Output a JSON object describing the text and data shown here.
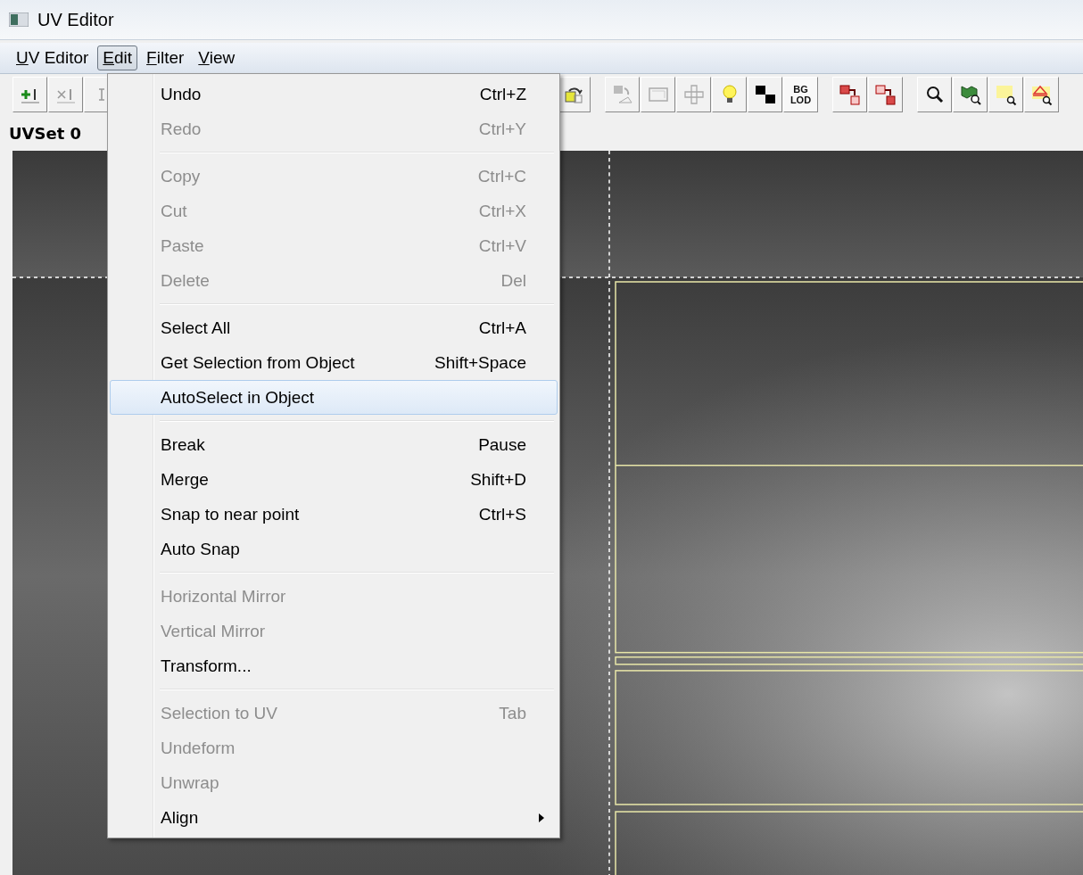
{
  "window": {
    "title": "UV Editor"
  },
  "menu_bar": [
    {
      "label": "UV Editor",
      "selected": false
    },
    {
      "label": "Edit",
      "selected": true
    },
    {
      "label": "Filter",
      "selected": false
    },
    {
      "label": "View",
      "selected": false
    }
  ],
  "toolbar": {
    "lod_button": "BG LOD"
  },
  "uv_set_label": "UVSet 0",
  "edit_menu": {
    "items": [
      {
        "kind": "item",
        "label": "Undo",
        "shortcut": "Ctrl+Z",
        "disabled": false,
        "selected": false
      },
      {
        "kind": "item",
        "label": "Redo",
        "shortcut": "Ctrl+Y",
        "disabled": true,
        "selected": false
      },
      {
        "kind": "separator"
      },
      {
        "kind": "item",
        "label": "Copy",
        "shortcut": "Ctrl+C",
        "disabled": true,
        "selected": false
      },
      {
        "kind": "item",
        "label": "Cut",
        "shortcut": "Ctrl+X",
        "disabled": true,
        "selected": false
      },
      {
        "kind": "item",
        "label": "Paste",
        "shortcut": "Ctrl+V",
        "disabled": true,
        "selected": false
      },
      {
        "kind": "item",
        "label": "Delete",
        "shortcut": "Del",
        "disabled": true,
        "selected": false
      },
      {
        "kind": "separator"
      },
      {
        "kind": "item",
        "label": "Select All",
        "shortcut": "Ctrl+A",
        "disabled": false,
        "selected": false
      },
      {
        "kind": "item",
        "label": "Get Selection from Object",
        "shortcut": "Shift+Space",
        "disabled": false,
        "selected": false
      },
      {
        "kind": "item",
        "label": "AutoSelect in Object",
        "disabled": false,
        "selected": true
      },
      {
        "kind": "separator"
      },
      {
        "kind": "item",
        "label": "Break",
        "shortcut": "Pause",
        "disabled": false,
        "selected": false
      },
      {
        "kind": "item",
        "label": "Merge",
        "shortcut": "Shift+D",
        "disabled": false,
        "selected": false
      },
      {
        "kind": "item",
        "label": "Snap to near point",
        "shortcut": "Ctrl+S",
        "disabled": false,
        "selected": false
      },
      {
        "kind": "item",
        "label": "Auto Snap",
        "disabled": false,
        "selected": false
      },
      {
        "kind": "separator"
      },
      {
        "kind": "item",
        "label": "Horizontal Mirror",
        "disabled": true,
        "selected": false
      },
      {
        "kind": "item",
        "label": "Vertical Mirror",
        "disabled": true,
        "selected": false
      },
      {
        "kind": "item",
        "label": "Transform...",
        "disabled": false,
        "selected": false
      },
      {
        "kind": "separator"
      },
      {
        "kind": "item",
        "label": "Selection to UV",
        "shortcut": "Tab",
        "disabled": true,
        "selected": false
      },
      {
        "kind": "item",
        "label": "Undeform",
        "disabled": true,
        "selected": false
      },
      {
        "kind": "item",
        "label": "Unwrap",
        "disabled": true,
        "selected": false
      },
      {
        "kind": "submenu",
        "label": "Align",
        "disabled": false,
        "selected": false
      }
    ]
  }
}
